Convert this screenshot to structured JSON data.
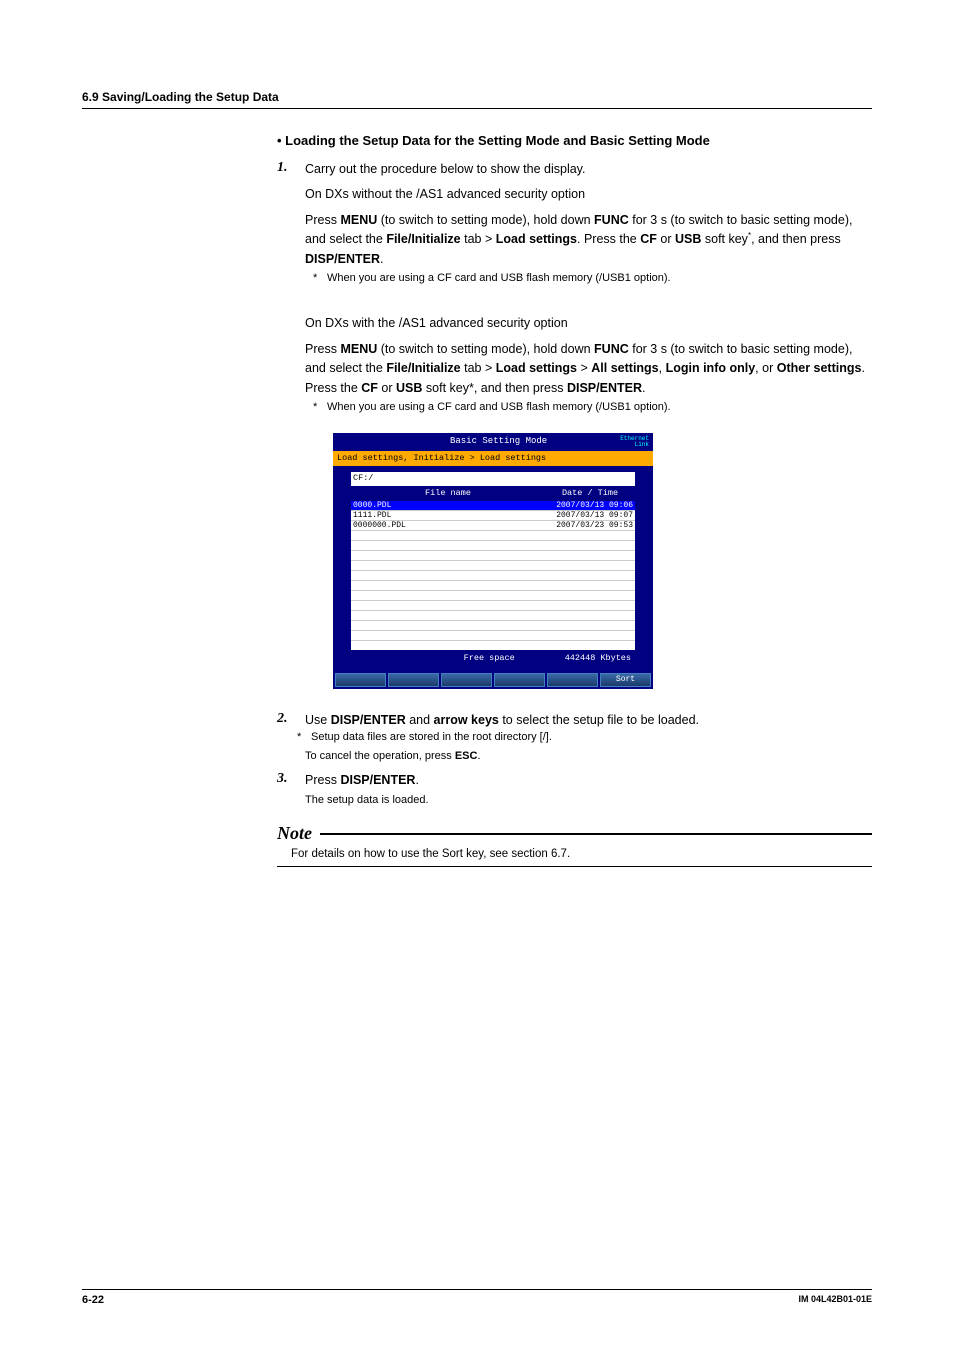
{
  "section_header": "6.9  Saving/Loading the Setup Data",
  "heading": "Loading the Setup Data for the Setting Mode and Basic Setting Mode",
  "step1": {
    "num": "1.",
    "line1": "Carry out the procedure below to show the display.",
    "line2": "On DXs without the /AS1 advanced security option",
    "p1_a": "Press ",
    "p1_menu": "MENU",
    "p1_b": " (to switch to setting mode), hold down ",
    "p1_func": "FUNC",
    "p1_c": " for 3 s (to switch to basic setting mode), and select the ",
    "p1_fi": "File/Initialize",
    "p1_d": " tab > ",
    "p1_ls": "Load settings",
    "p1_e": ". Press the ",
    "p1_cf": "CF",
    "p1_or": " or ",
    "p1_usb": "USB",
    "p1_f": " soft key",
    "p1_g": ", and then press ",
    "p1_de": "DISP/ENTER",
    "p1_h": ".",
    "foot1": "When you are using a CF card and USB flash memory (/USB1 option).",
    "line3": "On DXs with the /AS1 advanced security option",
    "p2_a": "Press ",
    "p2_menu": "MENU",
    "p2_b": " (to switch to setting mode), hold down ",
    "p2_func": "FUNC",
    "p2_c": " for 3 s (to switch to basic setting mode), and select the ",
    "p2_fi": "File/Initialize",
    "p2_d": " tab > ",
    "p2_ls": "Load settings",
    "p2_e": " > ",
    "p2_all": "All settings",
    "p2_f": ", ",
    "p2_login": "Login info only",
    "p2_g": ", or ",
    "p2_other": "Other settings",
    "p2_h": ". Press the ",
    "p2_cf": "CF",
    "p2_or": " or ",
    "p2_usb": "USB",
    "p2_i": " soft key*, and then press ",
    "p2_de": "DISP/ENTER",
    "p2_j": ".",
    "foot2": "When you are using a CF card and USB flash memory (/USB1 option)."
  },
  "screenshot": {
    "title": "Basic Setting Mode",
    "eth1": "Ethernet",
    "eth2": "Link",
    "breadcrumb": "Load settings, Initialize > Load settings",
    "path": "CF:/",
    "col_file": "File name",
    "col_date": "Date / Time",
    "rows": [
      {
        "name": "0000.PDL",
        "dt": "2007/03/13 09:06"
      },
      {
        "name": "1111.PDL",
        "dt": "2007/03/13 09:07"
      },
      {
        "name": "0000000.PDL",
        "dt": "2007/03/23 09:53"
      }
    ],
    "free_label": "Free space",
    "free_value": "442448 Kbytes",
    "sort": "Sort"
  },
  "step2": {
    "num": "2.",
    "a": "Use ",
    "de": "DISP/ENTER",
    "b": " and ",
    "ak": "arrow keys",
    "c": " to select the setup file to be loaded.",
    "foot": "Setup data files are stored in the root directory [/].",
    "cancel_a": "To cancel the operation, press ",
    "cancel_esc": "ESC",
    "cancel_b": "."
  },
  "step3": {
    "num": "3.",
    "a": "Press ",
    "de": "DISP/ENTER",
    "b": ".",
    "loaded": "The setup data is loaded."
  },
  "note": {
    "label": "Note",
    "body": "For details on how to use the Sort key, see section 6.7."
  },
  "footer": {
    "page": "6-22",
    "doc": "IM 04L42B01-01E"
  }
}
